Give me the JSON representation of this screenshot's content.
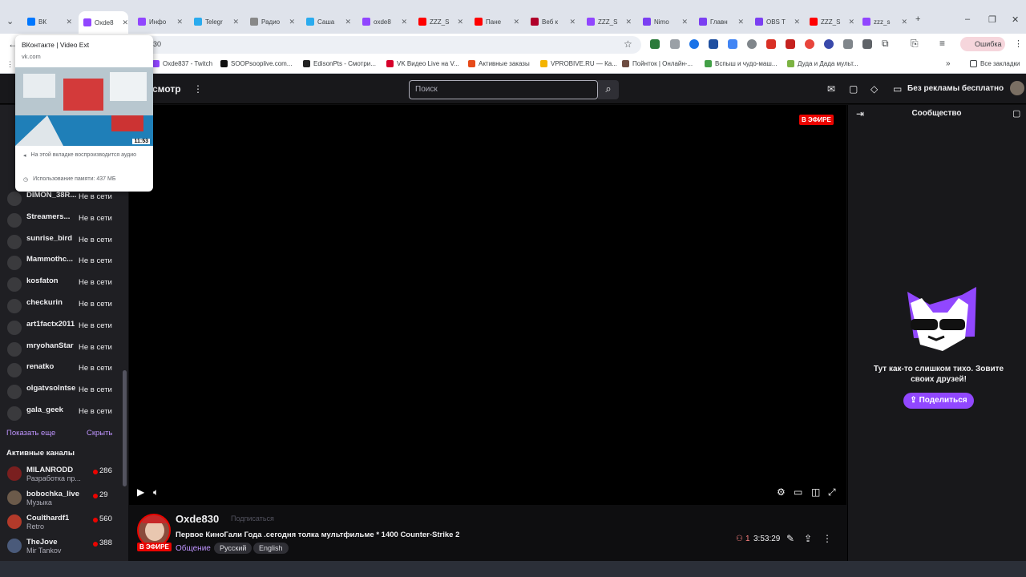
{
  "browser": {
    "tabs": [
      {
        "label": "ВК",
        "color": "#0077ff"
      },
      {
        "label": "Oxde8",
        "color": "#9146ff"
      },
      {
        "label": "Инфо",
        "color": "#9146ff"
      },
      {
        "label": "Telegr",
        "color": "#2aabee"
      },
      {
        "label": "Радио",
        "color": "#888888"
      },
      {
        "label": "Саша",
        "color": "#2aabee"
      },
      {
        "label": "oxde8",
        "color": "#9146ff"
      },
      {
        "label": "ZZZ_S",
        "color": "#ff0000"
      },
      {
        "label": "Пане",
        "color": "#ff0000"
      },
      {
        "label": "Веб к",
        "color": "#b0002a"
      },
      {
        "label": "ZZZ_S",
        "color": "#9146ff"
      },
      {
        "label": "Nimo",
        "color": "#7b3ff2"
      },
      {
        "label": "Главн",
        "color": "#7b3ff2"
      },
      {
        "label": "OBS T",
        "color": "#7b3ff2"
      },
      {
        "label": "ZZZ_S",
        "color": "#ff0000"
      },
      {
        "label": "zzz_s",
        "color": "#9146ff"
      }
    ],
    "address": "830",
    "error_label": "Ошибка",
    "bookmarks": [
      "Oxde837 - Twitch",
      "SOOPsooplive.com...",
      "EdisonPts - Смотри...",
      "VK Видео Live на V...",
      "Активные заказы",
      "VPROBIVE.RU — Ка...",
      "Пойнток | Онлайн-...",
      "Вспыш и чудо-маш...",
      "Дуда и Дада мульт..."
    ],
    "all_bookmarks": "Все закладки"
  },
  "hovercard": {
    "title": "ВКонтакте | Video Ext",
    "url": "vk.com",
    "thumb_time": "11:53",
    "audio_text": "На этой вкладке воспроизводится аудио",
    "memory_text": "Использование памяти: 437 МБ"
  },
  "header": {
    "browse_label": "смотр",
    "search_placeholder": "Поиск",
    "no_ads": "Без рекламы бесплатно"
  },
  "sidebar": {
    "offline_label": "Не в сети",
    "followed": [
      {
        "name": "DIMON_38R..."
      },
      {
        "name": "Streamers..."
      },
      {
        "name": "sunrise_bird"
      },
      {
        "name": "Mammothc..."
      },
      {
        "name": "kosfaton"
      },
      {
        "name": "checkurin"
      },
      {
        "name": "art1factx2011"
      },
      {
        "name": "mryohanStar"
      },
      {
        "name": "renatko"
      },
      {
        "name": "olgatvsolntse"
      },
      {
        "name": "gala_geek"
      }
    ],
    "show_more": "Показать еще",
    "hide": "Скрыть",
    "active_header": "Активные каналы",
    "active": [
      {
        "name": "MILANRODD",
        "game": "Разработка пр...",
        "viewers": "286"
      },
      {
        "name": "bobochka_live",
        "game": "Музыка",
        "viewers": "29"
      },
      {
        "name": "Coulthardf1",
        "game": "Retro",
        "viewers": "560"
      },
      {
        "name": "TheJove",
        "game": "Mir Tankov",
        "viewers": "388"
      }
    ]
  },
  "player": {
    "live_badge": "В ЭФИРЕ"
  },
  "stream": {
    "channel": "Oxde830",
    "follow_label": "Подписаться",
    "live_badge": "В ЭФИРЕ",
    "title": "Первое КиноГали Года .сегодня толка мультфильме * 1400 Counter-Strike 2",
    "category": "Общение",
    "tags": [
      "Русский",
      "English"
    ],
    "viewers": "1",
    "uptime": "3:53:29"
  },
  "community": {
    "title": "Сообщество",
    "message": "Тут как-то слишком тихо. Зовите своих друзей!",
    "share_label": "Поделиться"
  },
  "colors": {
    "accent": "#9147ff",
    "live": "#eb0400",
    "link": "#bf94ff"
  }
}
